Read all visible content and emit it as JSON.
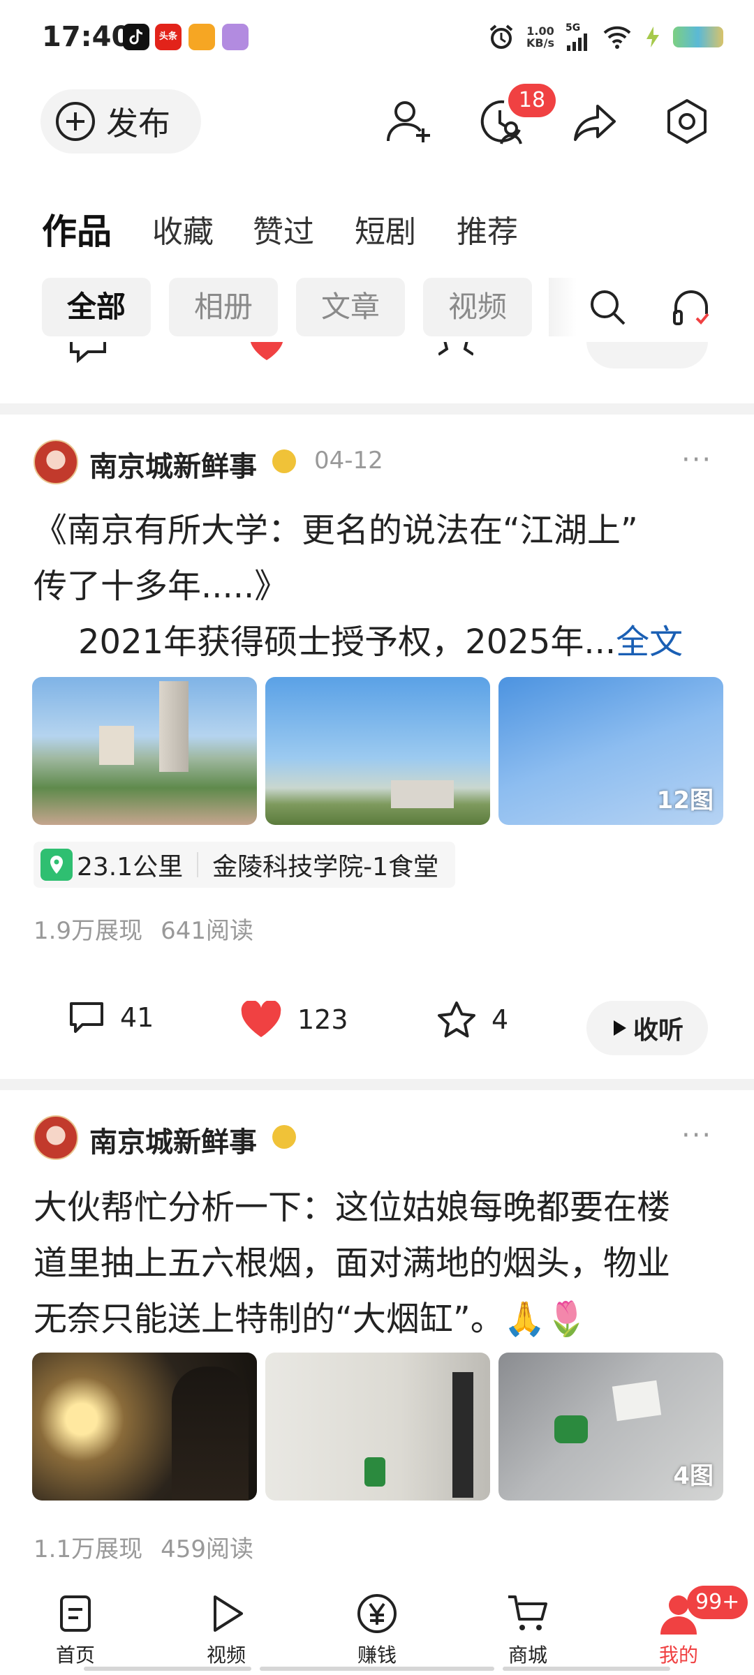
{
  "status_bar": {
    "time": "17:40",
    "net_speed_value": "1.00",
    "net_speed_unit": "KB/s",
    "net_type": "5G",
    "toutiao_label": "头条"
  },
  "header": {
    "publish_label": "发布",
    "notification_badge": "18"
  },
  "main_tabs": [
    "作品",
    "收藏",
    "赞过",
    "短剧",
    "推荐"
  ],
  "filter_chips": [
    "全部",
    "相册",
    "文章",
    "视频"
  ],
  "posts": [
    {
      "author": "南京城新鲜事",
      "date": "04-12",
      "text_line1": "《南京有所大学：更名的说法在“江湖上”",
      "text_line2": "传了十多年.....》",
      "text_line3": "2021年获得硕士授予权，2025年...",
      "full_text_link": "全文",
      "image_count": "12图",
      "location_distance": "23.1公里",
      "location_name": "金陵科技学院-1食堂",
      "impressions": "1.9万展现",
      "reads": "641阅读",
      "comments": "41",
      "likes": "123",
      "favorites": "4",
      "listen_label": "收听"
    },
    {
      "author": "南京城新鲜事",
      "text_line1": "大伙帮忙分析一下：这位姑娘每晚都要在楼",
      "text_line2": "道里抽上五六根烟，面对满地的烟头，物业",
      "text_line3": "无奈只能送上特制的“大烟缸”。🙏🌷",
      "image_count": "4图",
      "impressions": "1.1万展现",
      "reads": "459阅读"
    }
  ],
  "bottom_nav": {
    "items": [
      "首页",
      "视频",
      "赚钱",
      "商城",
      "我的"
    ],
    "me_badge": "99+"
  },
  "colors": {
    "accent": "#f04142",
    "link": "#1a5fb4",
    "chip_bg": "#f2f2f2"
  }
}
